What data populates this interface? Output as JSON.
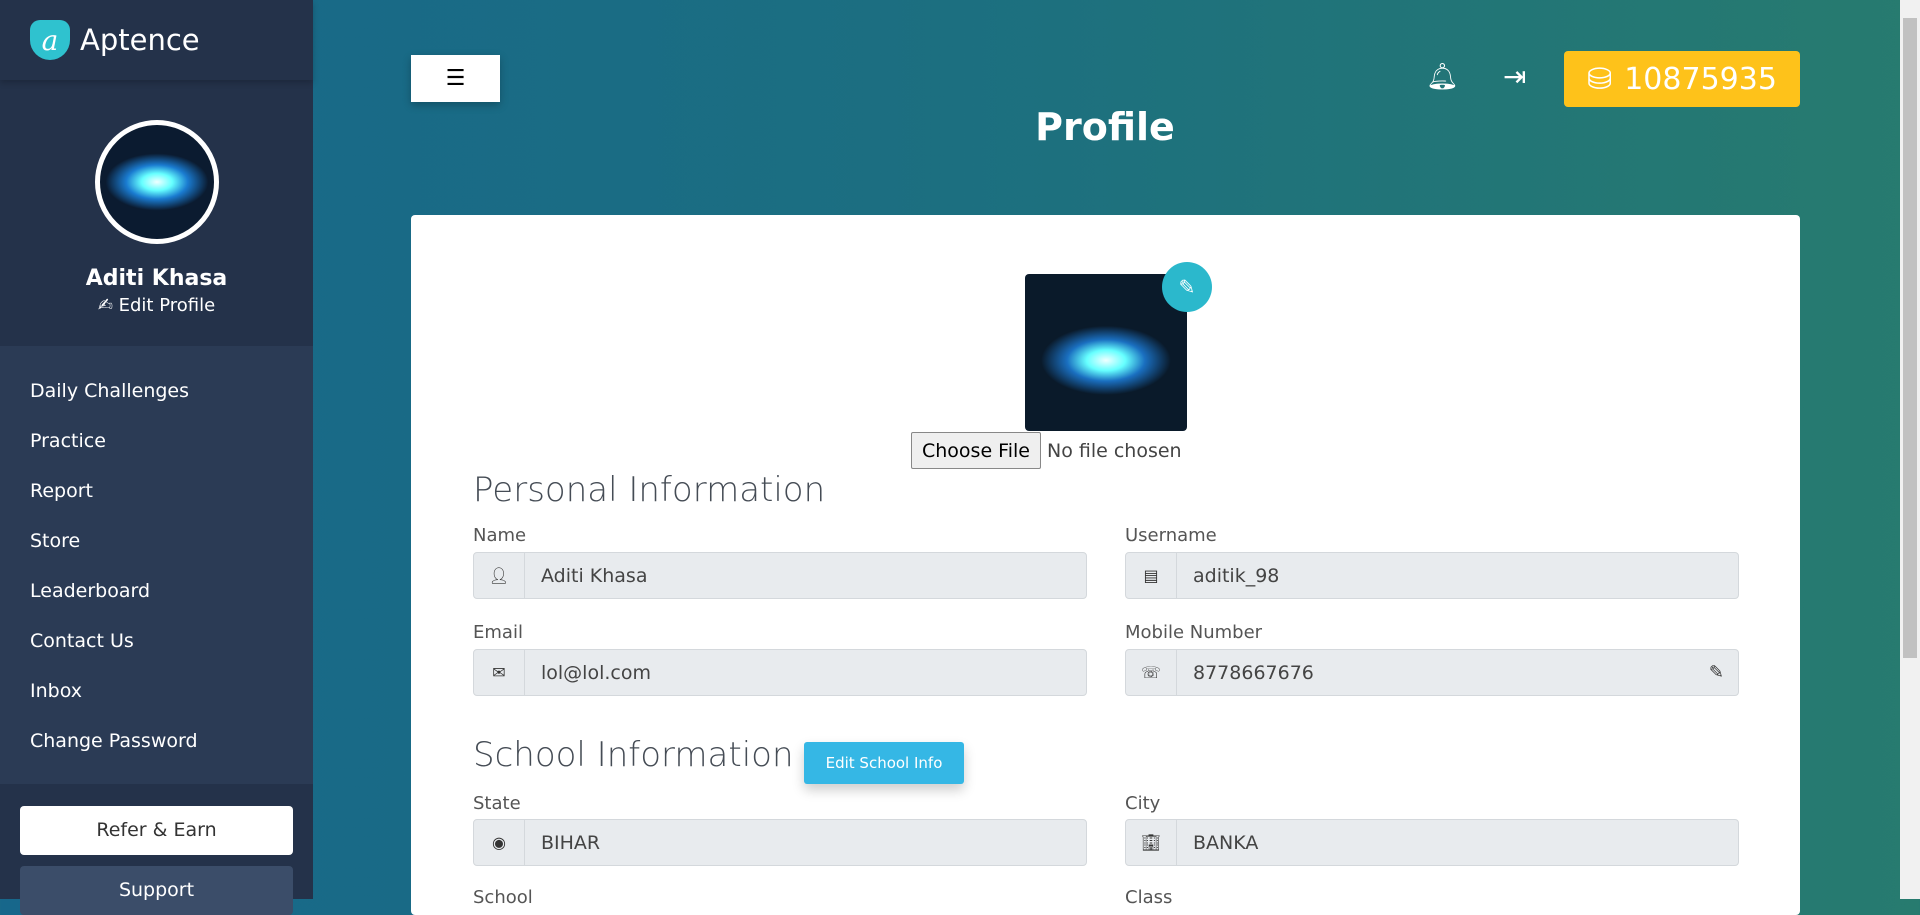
{
  "app": {
    "name": "Aptence",
    "logo_letter": "a"
  },
  "sidebar": {
    "user_name": "Aditi Khasa",
    "edit_profile": "Edit Profile",
    "items": [
      {
        "label": "Daily Challenges"
      },
      {
        "label": "Practice"
      },
      {
        "label": "Report"
      },
      {
        "label": "Store"
      },
      {
        "label": "Leaderboard"
      },
      {
        "label": "Contact Us"
      },
      {
        "label": "Inbox"
      },
      {
        "label": "Change Password"
      }
    ],
    "refer": "Refer & Earn",
    "support": "Support"
  },
  "header": {
    "title": "Profile",
    "coins": "10875935",
    "icons": [
      "menu-icon",
      "bell-icon",
      "logout-icon",
      "coins-icon"
    ]
  },
  "profile": {
    "choose_file": "Choose File",
    "no_file": "No file chosen",
    "personal_heading": "Personal Information",
    "name_label": "Name",
    "name": "Aditi Khasa",
    "username_label": "Username",
    "username": "aditik_98",
    "email_label": "Email",
    "email": "lol@lol.com",
    "mobile_label": "Mobile Number",
    "mobile": "8778667676",
    "school_heading": "School Information",
    "edit_school": "Edit School Info",
    "state_label": "State",
    "state": "BIHAR",
    "city_label": "City",
    "city": "BANKA",
    "school_label": "School",
    "class_label": "Class"
  },
  "colors": {
    "sidebar": "#2b3b55",
    "accent": "#35b7e5",
    "coins": "#fec21a"
  }
}
